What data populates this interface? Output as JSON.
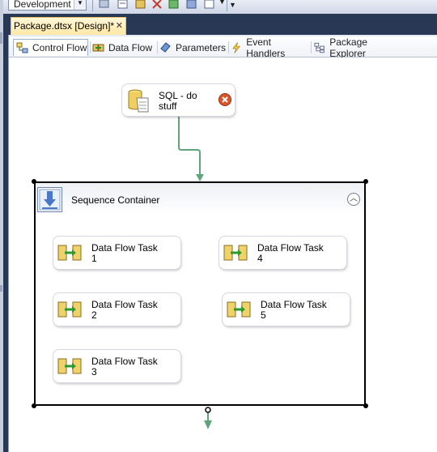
{
  "toolbar": {
    "configuration": "Development"
  },
  "document_tab": {
    "title": "Package.dtsx [Design]*",
    "close": "✕"
  },
  "designer_tabs": [
    {
      "label": "Control Flow",
      "icon": "control-flow-icon",
      "active": true
    },
    {
      "label": "Data Flow",
      "icon": "data-flow-icon",
      "active": false
    },
    {
      "label": "Parameters",
      "icon": "parameters-icon",
      "active": false
    },
    {
      "label": "Event Handlers",
      "icon": "event-handlers-icon",
      "active": false
    },
    {
      "label": "Package Explorer",
      "icon": "package-explorer-icon",
      "active": false
    }
  ],
  "sql_task": {
    "line1": "SQL - do",
    "line2": "stuff",
    "status": "error"
  },
  "container": {
    "title": "Sequence Container",
    "collapse_icon": "collapse-up-icon"
  },
  "dataflow_tasks": [
    {
      "line1": "Data Flow Task",
      "line2": "1"
    },
    {
      "line1": "Data Flow Task",
      "line2": "2"
    },
    {
      "line1": "Data Flow Task",
      "line2": "3"
    },
    {
      "line1": "Data Flow Task",
      "line2": "4"
    },
    {
      "line1": "Data Flow Task",
      "line2": "5"
    }
  ],
  "colors": {
    "connector": "#5fa57a",
    "error": "#d9552a",
    "doc_tab": "#ffe8a6",
    "ide_background": "#293955"
  }
}
